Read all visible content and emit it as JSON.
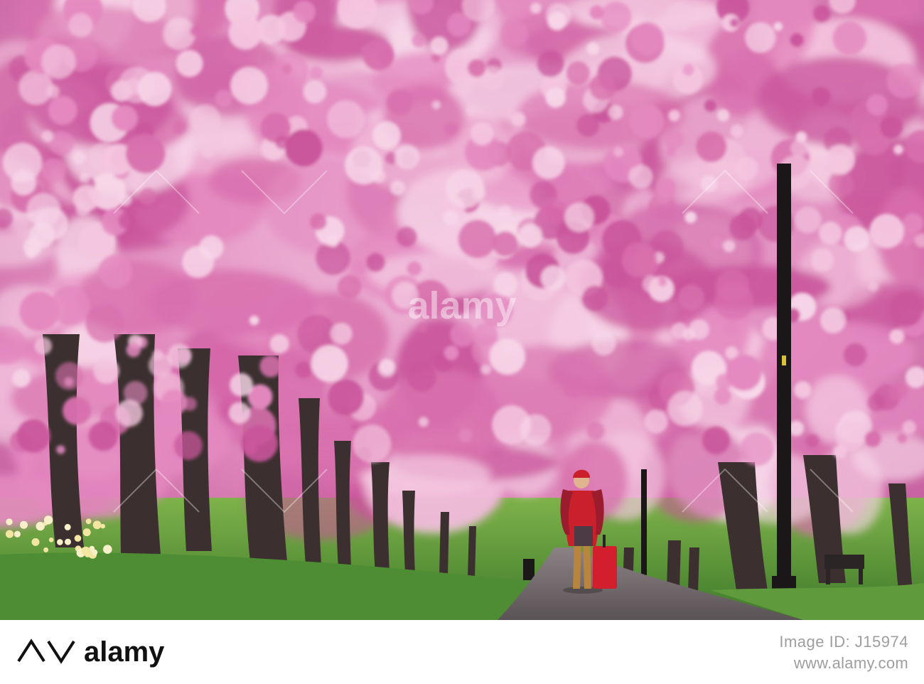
{
  "photo": {
    "description_icon": "photo-icon",
    "colors": {
      "blossom_light": "#f4c6df",
      "blossom_mid": "#e489c0",
      "blossom_deep": "#c9559b",
      "bark": "#3c3130",
      "grass": "#5f9a3c",
      "path": "#6a6365",
      "coat": "#c9202c"
    }
  },
  "watermark": {
    "brand": "alamy",
    "brand_color": "#ffffff"
  },
  "footer": {
    "logo_text": "alamy",
    "image_id": "Image ID: J15974",
    "url": "www.alamy.com",
    "text_color": "#9e9e9e"
  }
}
